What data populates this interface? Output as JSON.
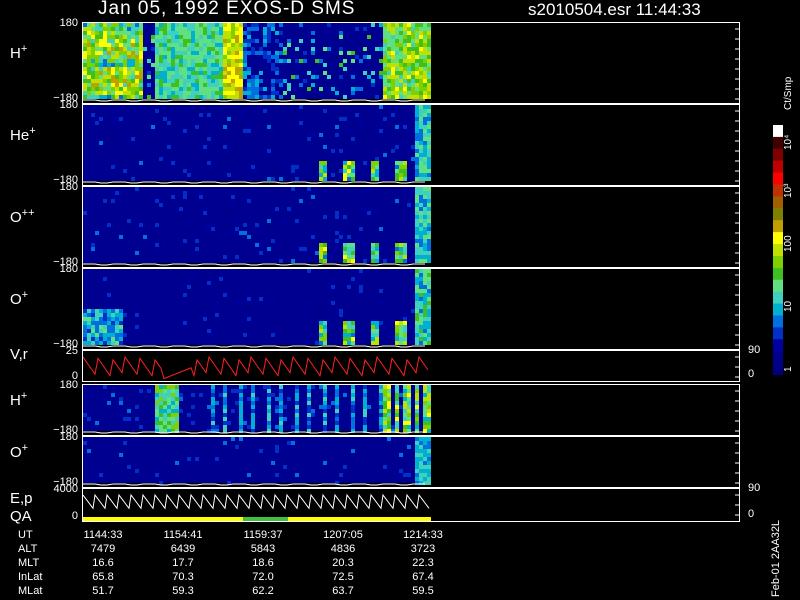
{
  "header": {
    "title": "Jan 05, 1992    EXOS-D SMS",
    "file_time": "s2010504.esr   11:44:33"
  },
  "colorbar": {
    "unit": "Ct/Smp",
    "labels": [
      "10⁴",
      "10³",
      "100",
      "10",
      "1"
    ],
    "colors": [
      "#000080",
      "#00008c",
      "#0000a0",
      "#0030c8",
      "#0070e0",
      "#00b0d0",
      "#40d0c0",
      "#60e080",
      "#40c020",
      "#80d000",
      "#c0e000",
      "#ffff00",
      "#c0a000",
      "#808000",
      "#a06000",
      "#c03000",
      "#ff0000",
      "#c00000",
      "#800000",
      "#400000",
      "#ffffff"
    ]
  },
  "vertical_label": "Feb-01  2AA32L",
  "chart_data": [
    {
      "type": "heatmap",
      "name": "H+",
      "label": "H",
      "sup": "+",
      "ylim": [
        -180,
        180
      ],
      "yticks": [
        "180",
        "−180"
      ],
      "kind": "hplus"
    },
    {
      "type": "heatmap",
      "name": "He+",
      "label": "He",
      "sup": "+",
      "ylim": [
        -180,
        180
      ],
      "yticks": [
        "180",
        "−180"
      ],
      "kind": "heplus"
    },
    {
      "type": "heatmap",
      "name": "O++",
      "label": "O",
      "sup": "++",
      "ylim": [
        -180,
        180
      ],
      "yticks": [
        "180",
        "−180"
      ],
      "kind": "opp"
    },
    {
      "type": "heatmap",
      "name": "O+",
      "label": "O",
      "sup": "+",
      "ylim": [
        -180,
        180
      ],
      "yticks": [
        "180",
        "−180"
      ],
      "kind": "oplus"
    },
    {
      "type": "line",
      "name": "V,r",
      "label": "V,r",
      "sup": "",
      "ylim": [
        0,
        25
      ],
      "yticks": [
        "25",
        "0"
      ],
      "right_ticks": [
        "90",
        "0"
      ],
      "kind": "vr"
    },
    {
      "type": "heatmap",
      "name": "H+ (low)",
      "label": "H",
      "sup": "+",
      "ylim": [
        -180,
        180
      ],
      "yticks": [
        "180",
        "−180"
      ],
      "kind": "hplus2"
    },
    {
      "type": "heatmap",
      "name": "O+ (low)",
      "label": "O",
      "sup": "+",
      "ylim": [
        -180,
        180
      ],
      "yticks": [
        "180",
        "−180"
      ],
      "kind": "oplus2"
    },
    {
      "type": "line",
      "name": "E,p",
      "label": "E,p",
      "label2": "QA",
      "sup": "",
      "ylim": [
        0,
        4000
      ],
      "yticks": [
        "4000",
        "0"
      ],
      "right_ticks": [
        "90",
        "0"
      ],
      "kind": "ep"
    }
  ],
  "axis_table": {
    "rows": [
      {
        "name": "UT",
        "values": [
          "1144:33",
          "1154:41",
          "1159:37",
          "1207:05",
          "1214:33"
        ]
      },
      {
        "name": "ALT",
        "values": [
          "7479",
          "6439",
          "5843",
          "4836",
          "3723"
        ]
      },
      {
        "name": "MLT",
        "values": [
          "16.6",
          "17.7",
          "18.6",
          "20.3",
          "22.3"
        ]
      },
      {
        "name": "InLat",
        "values": [
          "65.8",
          "70.3",
          "72.0",
          "72.5",
          "67.4"
        ]
      },
      {
        "name": "MLat",
        "values": [
          "51.7",
          "59.3",
          "62.2",
          "63.7",
          "59.5"
        ]
      }
    ]
  }
}
